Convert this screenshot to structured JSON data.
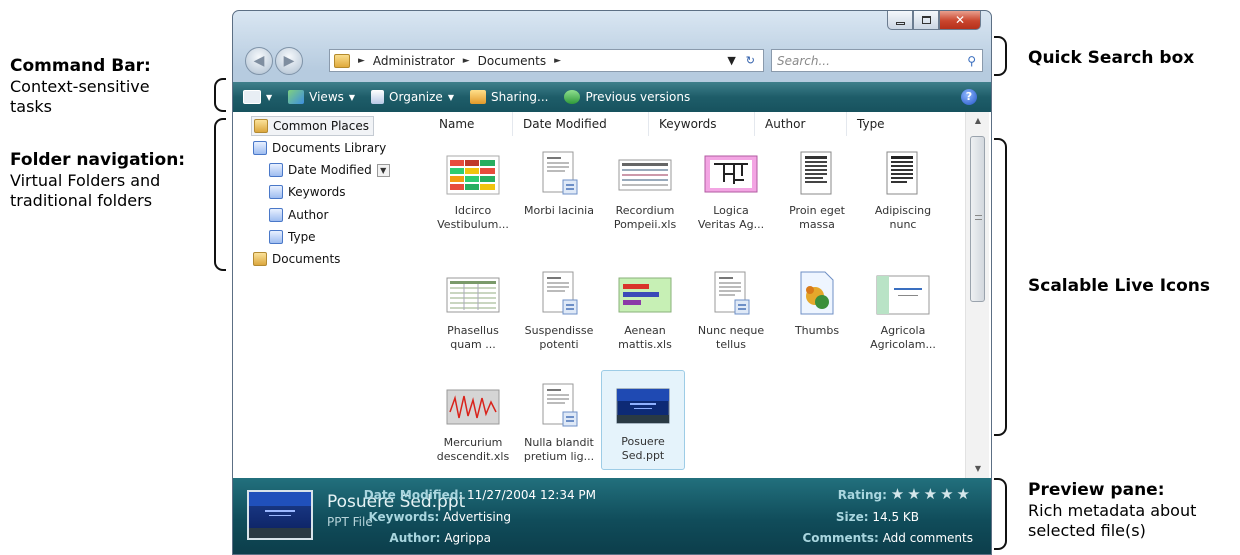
{
  "annotations": {
    "command_bar": {
      "heading": "Command Bar:",
      "lines": [
        "Context-sensitive",
        "tasks"
      ]
    },
    "folder_navigation": {
      "heading": "Folder navigation:",
      "lines": [
        "Virtual Folders and",
        "traditional folders"
      ]
    },
    "quick_search": {
      "heading": "Quick Search box"
    },
    "live_icons": {
      "heading": "Scalable Live Icons"
    },
    "preview_pane": {
      "heading": "Preview pane:",
      "lines": [
        "Rich metadata about",
        "selected file(s)"
      ]
    }
  },
  "window": {
    "address": {
      "crumbs": [
        "Administrator",
        "Documents"
      ]
    },
    "search_placeholder": "Search...",
    "command_bar": {
      "views": "Views",
      "organize": "Organize",
      "sharing": "Sharing...",
      "previous_versions": "Previous versions"
    },
    "nav": {
      "common_places": "Common Places",
      "documents_library": "Documents Library",
      "date_modified": "Date Modified",
      "keywords": "Keywords",
      "author": "Author",
      "type": "Type",
      "documents": "Documents"
    },
    "columns": [
      "Name",
      "Date Modified",
      "Keywords",
      "Author",
      "Type"
    ],
    "files": [
      {
        "line1": "Idcirco",
        "line2": "Vestibulum...",
        "icon": "spreadsheet-heatmap-icon"
      },
      {
        "line1": "Morbi lacinia",
        "line2": "",
        "icon": "document-icon"
      },
      {
        "line1": "Recordium",
        "line2": "Pompeii.xls",
        "icon": "spreadsheet-icon"
      },
      {
        "line1": "Logica",
        "line2": "Veritas Ag...",
        "icon": "diagram-icon"
      },
      {
        "line1": "Proin eget",
        "line2": "massa",
        "icon": "text-document-icon"
      },
      {
        "line1": "Adipiscing",
        "line2": "nunc",
        "icon": "text-document-icon"
      },
      {
        "line1": "Phasellus",
        "line2": "quam ...",
        "icon": "table-icon"
      },
      {
        "line1": "Suspendisse",
        "line2": "potenti",
        "icon": "document-icon"
      },
      {
        "line1": "Aenean",
        "line2": "mattis.xls",
        "icon": "bar-chart-icon"
      },
      {
        "line1": "Nunc neque",
        "line2": "tellus",
        "icon": "document-icon"
      },
      {
        "line1": "Thumbs",
        "line2": "",
        "icon": "thumbs-db-icon"
      },
      {
        "line1": "Agricola",
        "line2": "Agricolam...",
        "icon": "slide-icon"
      },
      {
        "line1": "Mercurium",
        "line2": "descendit.xls",
        "icon": "line-chart-icon"
      },
      {
        "line1": "Nulla blandit",
        "line2": "pretium lig...",
        "icon": "document-icon"
      },
      {
        "line1": "Posuere",
        "line2": "Sed.ppt",
        "icon": "presentation-icon"
      }
    ],
    "preview": {
      "name": "Posuere Sed.ppt",
      "type": "PPT File",
      "date_modified_label": "Date Modified:",
      "date_modified": "11/27/2004 12:34 PM",
      "keywords_label": "Keywords:",
      "keywords": "Advertising",
      "author_label": "Author:",
      "author": "Agrippa",
      "rating_label": "Rating:",
      "rating_stars": "★★★★★",
      "size_label": "Size:",
      "size": "14.5 KB",
      "comments_label": "Comments:",
      "comments": "Add comments"
    }
  }
}
